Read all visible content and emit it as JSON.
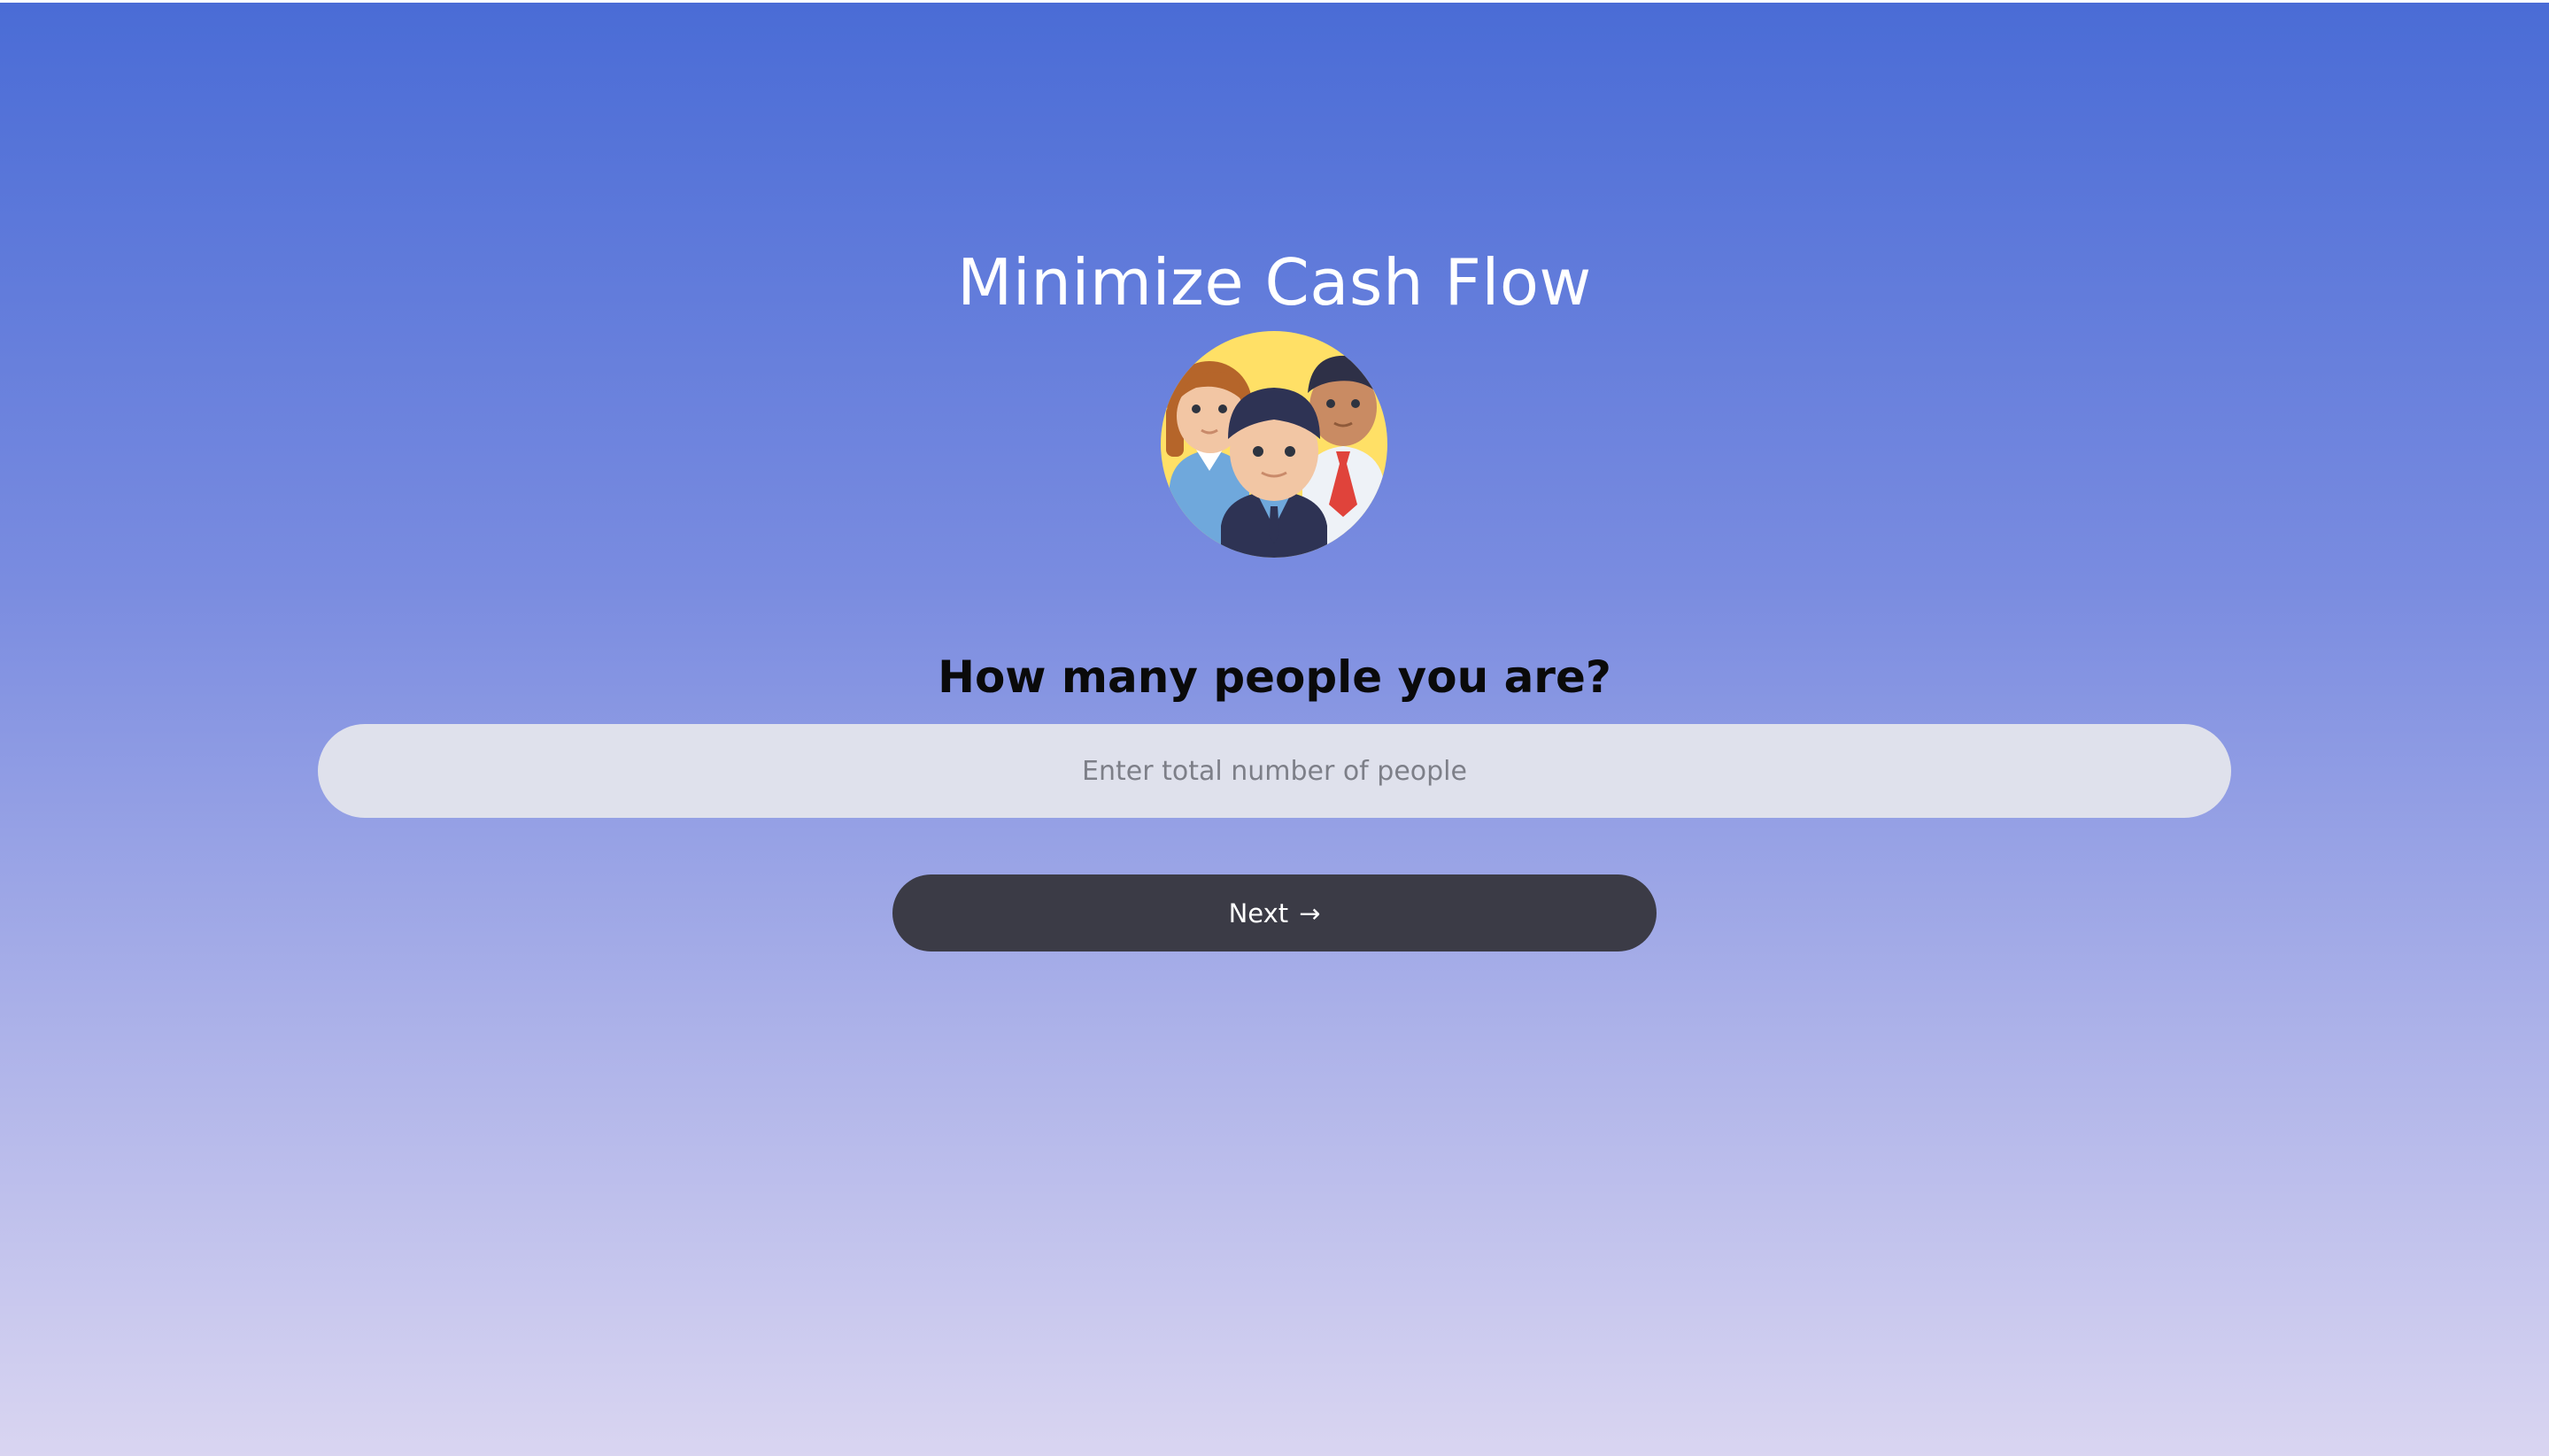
{
  "app": {
    "title": "Minimize Cash Flow"
  },
  "hero": {
    "icon": "group-people-icon"
  },
  "question": {
    "text": "How many people you are?"
  },
  "people_input": {
    "placeholder": "Enter total number of people",
    "value": ""
  },
  "next_button": {
    "label": "Next",
    "arrow": "→"
  },
  "colors": {
    "gradient_top": "#4a6cd6",
    "gradient_bottom": "#d9d5f1",
    "button_bg": "#3b3b46",
    "input_bg": "#dfe1ec",
    "hero_circle": "#ffe066"
  }
}
